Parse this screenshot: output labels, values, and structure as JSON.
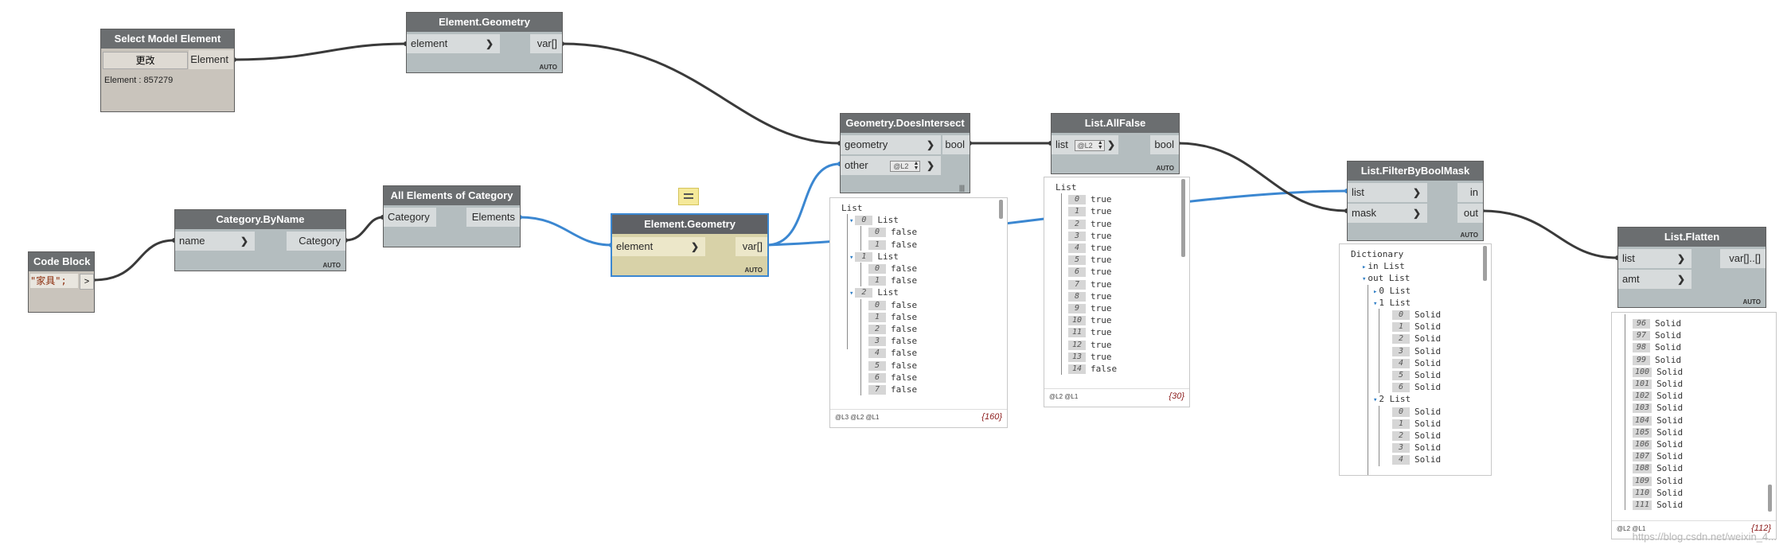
{
  "canvas": {
    "background": "#ffffff",
    "wire_color": "#3a3a3a",
    "selected_wire_color": "#3b87d1"
  },
  "nodes": {
    "select_model": {
      "title": "Select Model Element",
      "button": "更改",
      "output": "Element",
      "info": "Element : 857279"
    },
    "geometry_top": {
      "title": "Element.Geometry",
      "input": "element",
      "output": "var[]",
      "lacing": "AUTO"
    },
    "code_block": {
      "title": "Code Block",
      "code": "\"家具\";",
      "output": ">"
    },
    "category_byname": {
      "title": "Category.ByName",
      "input": "name",
      "output": "Category",
      "lacing": "AUTO"
    },
    "all_elements": {
      "title": "All Elements of Category",
      "input": "Category",
      "output": "Elements"
    },
    "geometry_sel": {
      "title": "Element.Geometry",
      "input": "element",
      "output": "var[]",
      "lacing": "AUTO",
      "note_icon": "note-icon"
    },
    "does_intersect": {
      "title": "Geometry.DoesIntersect",
      "input1": "geometry",
      "input2": "other",
      "input2_level": "@L2",
      "output": "bool",
      "lacing": "|||"
    },
    "all_false": {
      "title": "List.AllFalse",
      "input": "list",
      "input_level": "@L2",
      "output": "bool",
      "lacing": "AUTO"
    },
    "filter_mask": {
      "title": "List.FilterByBoolMask",
      "input1": "list",
      "input2": "mask",
      "output1": "in",
      "output2": "out",
      "lacing": "AUTO"
    },
    "flatten": {
      "title": "List.Flatten",
      "input1": "list",
      "input2": "amt",
      "output": "var[]..[]",
      "lacing": "AUTO"
    }
  },
  "preview_intersect": {
    "root": "List",
    "groups": [
      {
        "index": "0",
        "label": "List",
        "items": [
          {
            "i": "0",
            "v": "false"
          },
          {
            "i": "1",
            "v": "false"
          }
        ]
      },
      {
        "index": "1",
        "label": "List",
        "items": [
          {
            "i": "0",
            "v": "false"
          },
          {
            "i": "1",
            "v": "false"
          }
        ]
      },
      {
        "index": "2",
        "label": "List",
        "items": [
          {
            "i": "0",
            "v": "false"
          },
          {
            "i": "1",
            "v": "false"
          },
          {
            "i": "2",
            "v": "false"
          },
          {
            "i": "3",
            "v": "false"
          },
          {
            "i": "4",
            "v": "false"
          },
          {
            "i": "5",
            "v": "false"
          },
          {
            "i": "6",
            "v": "false"
          },
          {
            "i": "7",
            "v": "false"
          }
        ]
      }
    ],
    "levels": "@L3 @L2 @L1",
    "count": "{160}"
  },
  "preview_allfalse": {
    "root": "List",
    "items": [
      {
        "i": "0",
        "v": "true"
      },
      {
        "i": "1",
        "v": "true"
      },
      {
        "i": "2",
        "v": "true"
      },
      {
        "i": "3",
        "v": "true"
      },
      {
        "i": "4",
        "v": "true"
      },
      {
        "i": "5",
        "v": "true"
      },
      {
        "i": "6",
        "v": "true"
      },
      {
        "i": "7",
        "v": "true"
      },
      {
        "i": "8",
        "v": "true"
      },
      {
        "i": "9",
        "v": "true"
      },
      {
        "i": "10",
        "v": "true"
      },
      {
        "i": "11",
        "v": "true"
      },
      {
        "i": "12",
        "v": "true"
      },
      {
        "i": "13",
        "v": "true"
      },
      {
        "i": "14",
        "v": "false"
      }
    ],
    "levels": "@L2 @L1",
    "count": "{30}"
  },
  "preview_filter": {
    "root": "Dictionary",
    "in_label": "in List",
    "out_label": "out List",
    "sub0": "0 List",
    "sub1": "1 List",
    "sub1_items": [
      {
        "i": "0",
        "v": "Solid"
      },
      {
        "i": "1",
        "v": "Solid"
      },
      {
        "i": "2",
        "v": "Solid"
      },
      {
        "i": "3",
        "v": "Solid"
      },
      {
        "i": "4",
        "v": "Solid"
      },
      {
        "i": "5",
        "v": "Solid"
      },
      {
        "i": "6",
        "v": "Solid"
      }
    ],
    "sub2": "2 List",
    "sub2_items": [
      {
        "i": "0",
        "v": "Solid"
      },
      {
        "i": "1",
        "v": "Solid"
      },
      {
        "i": "2",
        "v": "Solid"
      },
      {
        "i": "3",
        "v": "Solid"
      },
      {
        "i": "4",
        "v": "Solid"
      }
    ]
  },
  "preview_flatten": {
    "items": [
      {
        "i": "96",
        "v": "Solid"
      },
      {
        "i": "97",
        "v": "Solid"
      },
      {
        "i": "98",
        "v": "Solid"
      },
      {
        "i": "99",
        "v": "Solid"
      },
      {
        "i": "100",
        "v": "Solid"
      },
      {
        "i": "101",
        "v": "Solid"
      },
      {
        "i": "102",
        "v": "Solid"
      },
      {
        "i": "103",
        "v": "Solid"
      },
      {
        "i": "104",
        "v": "Solid"
      },
      {
        "i": "105",
        "v": "Solid"
      },
      {
        "i": "106",
        "v": "Solid"
      },
      {
        "i": "107",
        "v": "Solid"
      },
      {
        "i": "108",
        "v": "Solid"
      },
      {
        "i": "109",
        "v": "Solid"
      },
      {
        "i": "110",
        "v": "Solid"
      },
      {
        "i": "111",
        "v": "Solid"
      }
    ],
    "levels": "@L2 @L1",
    "count": "{112}"
  },
  "watermark": "https://blog.csdn.net/weixin_4..."
}
